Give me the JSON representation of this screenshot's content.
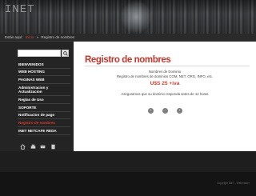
{
  "header": {
    "logo_text": "INET"
  },
  "breadcrumb": {
    "prefix": "Estás aquí:",
    "home": "Inicio",
    "separator": "»",
    "current": "Registro de nombres"
  },
  "search": {
    "placeholder": ""
  },
  "nav": {
    "items": [
      {
        "label": "BIENVENIDOS"
      },
      {
        "label": "WEB HOSTING"
      },
      {
        "label": "PAGINAS WEB"
      },
      {
        "label": "Administracion y Actualizacion"
      },
      {
        "label": "Reglas de Uso"
      },
      {
        "label": "SOPORTE"
      },
      {
        "label": "Notificacion de pago"
      },
      {
        "label": "Registro de nombres"
      },
      {
        "label": "INET NETCAFE REDA"
      }
    ],
    "active_index": 7
  },
  "content": {
    "title": "Registro de nombres",
    "line1": "Nombres de Dominio",
    "line2": "Registro de nombres de dominios COM, NET, ORG, INFO, etc.",
    "price": "U$S 25 +iva",
    "line3": "Aseguramos que su dominio responda antes de 12 horas"
  },
  "footer": {
    "credit": "Copyright INET - Webmaster"
  },
  "colors": {
    "accent": "#c0362c",
    "active_nav": "#e03a2a"
  },
  "icons": [
    "home-icon",
    "print-icon",
    "email-icon",
    "sitemap-icon"
  ]
}
